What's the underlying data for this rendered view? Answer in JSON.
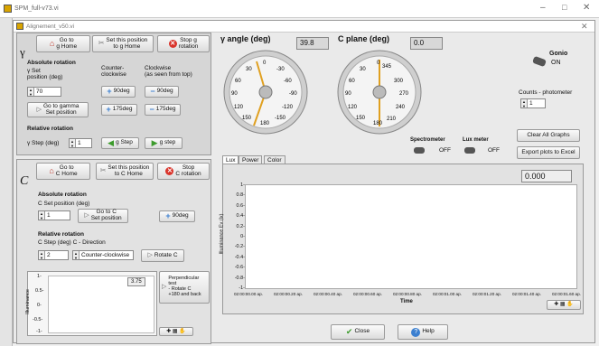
{
  "outer_title": "SPM_full-v73.vi",
  "window_title": "Alignement_v50.vi",
  "gamma": {
    "symbol": "γ",
    "goto_home": "Go to\ng Home",
    "set_home": "Set this position\nto g Home",
    "stop": "Stop g\nrotation",
    "abs_title": "Absolute rotation",
    "set_label": "γ Set\nposition (deg)",
    "set_value": "70",
    "ccw_label": "Counter-\nclockwise",
    "cw_label": "Clockwise\n(as seen from top)",
    "b90p": "90deg",
    "b90m": "90deg",
    "b175p": "175deg",
    "b175m": "175deg",
    "goto_set": "Go to gamma\nSet position",
    "rel_title": "Relative rotation",
    "step_label": "γ Step (deg)",
    "step_value": "1",
    "gstep_minus": "g Step",
    "gstep_plus": "g step"
  },
  "c": {
    "symbol": "C",
    "goto_home": "Go to\nC Home",
    "set_home": "Set this position\nto C Home",
    "stop": "Stop\nC rotation",
    "abs_title": "Absolute rotation",
    "set_label": "C Set position (deg)",
    "set_value": "1",
    "goto_set": "Go to C\nSet position",
    "b90": "90deg",
    "rel_title": "Relative rotation",
    "step_label": "C Step (deg)   C - Direction",
    "step_value": "2",
    "direction": "Counter-clockwise",
    "rotate": "Rotate C"
  },
  "mini_chart": {
    "ylabel": "Illuminance",
    "value": "3.75",
    "ticks": [
      "1-",
      "0.5-",
      "0-",
      "-0.5-",
      "-1-"
    ]
  },
  "perp_button": "Perpendicular\ntest\n- Rotate C\n+180 and back",
  "gauge_gamma": {
    "title": "γ angle (deg)",
    "value": "39.8",
    "ticks": [
      "0",
      "30",
      "-30",
      "60",
      "-60",
      "90",
      "-90",
      "120",
      "-120",
      "150",
      "-150",
      "180"
    ]
  },
  "gauge_c": {
    "title": "C plane (deg)",
    "value": "0.0",
    "ticks": [
      "0",
      "345",
      "30",
      "300",
      "60",
      "90",
      "270",
      "120",
      "240",
      "150",
      "180",
      "210"
    ]
  },
  "gonio": {
    "label": "Gonio",
    "state": "ON"
  },
  "counts": {
    "label": "Counts - photometer",
    "value": "1"
  },
  "spectrometer": {
    "label": "Spectrometer",
    "state": "OFF"
  },
  "luxmeter": {
    "label": "Lux meter",
    "state": "OFF"
  },
  "clear_graphs": "Clear All Graphs",
  "export_excel": "Export plots to Excel",
  "tabs": [
    "Lux",
    "Power",
    "Color"
  ],
  "lux_chart": {
    "value": "0.000",
    "ylabel": "Illuminance Ev (lx)",
    "xlabel": "Time",
    "yticks": [
      "1-",
      "0.8-",
      "0.6-",
      "0.4-",
      "0.2-",
      "0-",
      "-0.2-",
      "-0.4-",
      "-0.6-",
      "-0.8-",
      "-1-"
    ],
    "xticks": [
      "02:00:00.00 ap.",
      "02:00:00.20 ap.",
      "02:00:00.40 ap.",
      "02:00:00.60 ap.",
      "02:00:00.80 ap.",
      "02:00:01.00 ap.",
      "02:00:01.20 ap.",
      "02:00:01.40 ap.",
      "02:00:01.60 ap."
    ]
  },
  "close": "Close",
  "help": "Help"
}
